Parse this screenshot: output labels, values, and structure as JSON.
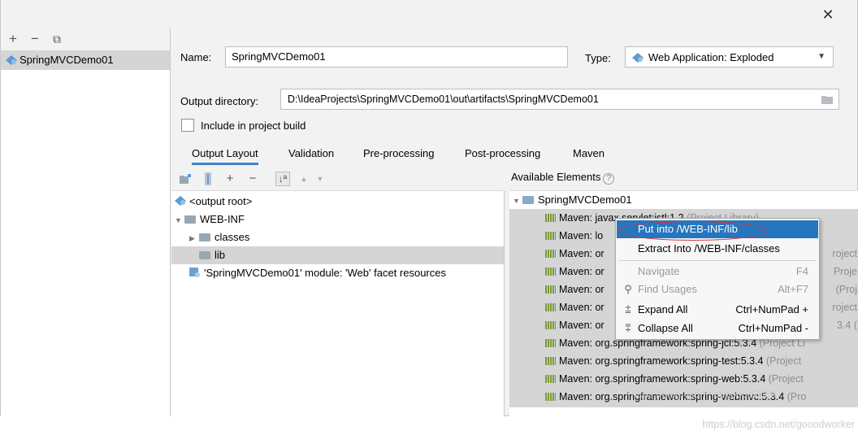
{
  "window": {
    "close_symbol": "✕"
  },
  "left_toolbar": {
    "add": "+",
    "remove": "−",
    "copy": "⧉"
  },
  "artifacts": [
    {
      "label": "SpringMVCDemo01"
    }
  ],
  "form": {
    "name_label": "Name:",
    "name_value": "SpringMVCDemo01",
    "type_label": "Type:",
    "type_value": "Web Application: Exploded",
    "output_label": "Output directory:",
    "output_value": "D:\\IdeaProjects\\SpringMVCDemo01\\out\\artifacts\\SpringMVCDemo01",
    "include_label": "Include in project build",
    "include_checked": false
  },
  "tabs": [
    "Output Layout",
    "Validation",
    "Pre-processing",
    "Post-processing",
    "Maven"
  ],
  "output_tree": [
    {
      "label": "<output root>"
    },
    {
      "label": "WEB-INF"
    },
    {
      "label": "classes"
    },
    {
      "label": "lib"
    },
    {
      "label": "'SpringMVCDemo01' module: 'Web' facet resources"
    }
  ],
  "available": {
    "title": "Available Elements",
    "help": "?",
    "root": "SpringMVCDemo01",
    "items": [
      {
        "name": "Maven: javax.servlet:jstl:1.2",
        "suffix": "(Project Library)"
      },
      {
        "name": "Maven: lo",
        "suffix": ""
      },
      {
        "name": "Maven: or",
        "suffix": "roject"
      },
      {
        "name": "Maven: or",
        "suffix": "Proje"
      },
      {
        "name": "Maven: or",
        "suffix": "(Proj"
      },
      {
        "name": "Maven: or",
        "suffix": "roject"
      },
      {
        "name": "Maven: or",
        "suffix": "3.4 ("
      },
      {
        "name": "Maven: org.springframework:spring-jcl:5.3.4",
        "suffix": "(Project Li"
      },
      {
        "name": "Maven: org.springframework:spring-test:5.3.4",
        "suffix": "(Project"
      },
      {
        "name": "Maven: org.springframework:spring-web:5.3.4",
        "suffix": "(Project"
      },
      {
        "name": "Maven: org.springframework:spring-webmvc:5.3.4",
        "suffix": "(Pro"
      }
    ]
  },
  "context_menu": {
    "put_into": "Put into /WEB-INF/lib",
    "extract_into": "Extract Into /WEB-INF/classes",
    "navigate": "Navigate",
    "navigate_shortcut": "F4",
    "find_usages": "Find Usages",
    "find_usages_shortcut": "Alt+F7",
    "expand_all": "Expand All",
    "expand_all_shortcut": "Ctrl+NumPad +",
    "collapse_all": "Collapse All",
    "collapse_all_shortcut": "Ctrl+NumPad -"
  },
  "watermark": {
    "overlay": "https://blog.csdn.net/goood2006",
    "bottom": "https://blog.csdn.net/gooodworker"
  },
  "colors": {
    "selection": "#2675bf",
    "annotation": "#d9363e",
    "tab_underline": "#4083c9"
  }
}
